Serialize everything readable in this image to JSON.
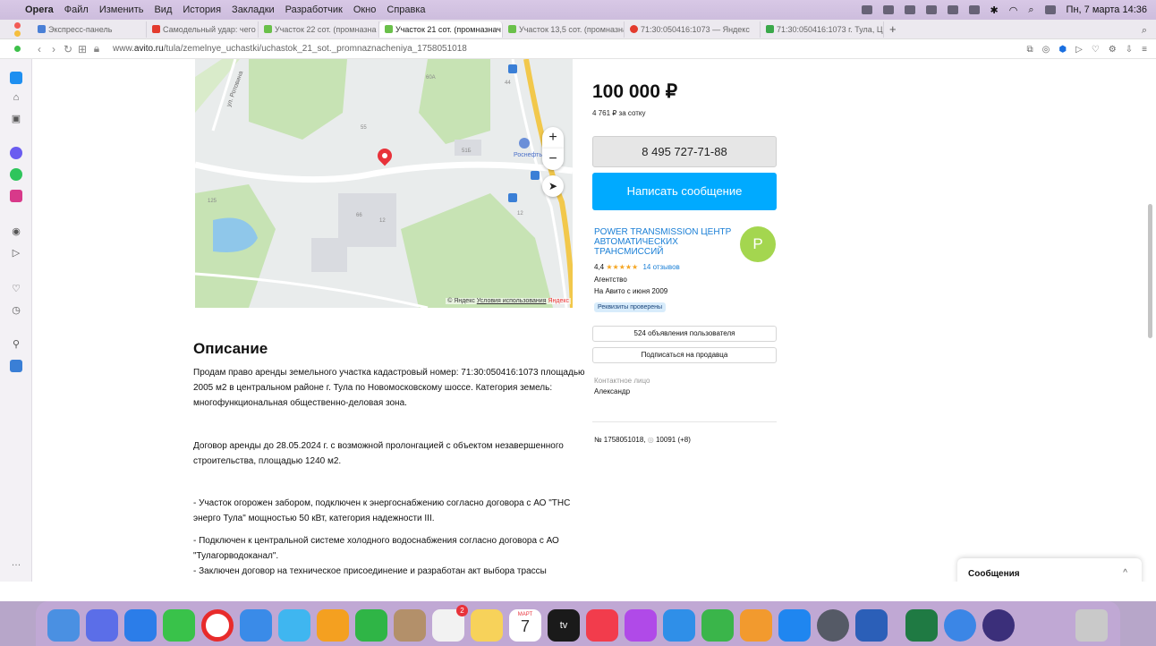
{
  "menubar": {
    "app": "Opera",
    "items": [
      "Файл",
      "Изменить",
      "Вид",
      "История",
      "Закладки",
      "Разработчик",
      "Окно",
      "Справка"
    ],
    "clock": "Пн, 7 марта  14:36"
  },
  "tabs": [
    {
      "label": "Экспресс-панель",
      "color": "#4a7fd6"
    },
    {
      "label": "Самодельный удар: чего ждё",
      "color": "#e33b2e"
    },
    {
      "label": "Участок 22 сот. (промназна",
      "color": "#6ac04a"
    },
    {
      "label": "Участок 21 сот. (промназнач",
      "color": "#6ac04a"
    },
    {
      "label": "Участок 13,5 сот. (промназна",
      "color": "#6ac04a"
    },
    {
      "label": "71:30:050416:1073 — Яндекс",
      "color": "#e33b2e"
    },
    {
      "label": "71:30:050416:1073 г. Тула, Ц",
      "color": "#3aa84a"
    }
  ],
  "address": {
    "prefix": "www.",
    "host": "avito.ru",
    "path": "/tula/zemelnye_uchastki/uchastok_21_sot._promnaznacheniya_1758051018"
  },
  "map": {
    "street": "ул. Ротовина",
    "plus": "+",
    "minus": "−",
    "copyright": "© Яндекс",
    "terms": "Условия использования",
    "brand": "Яндекс",
    "poi": "Роснефть",
    "labels": [
      "60А",
      "55",
      "51Б",
      "66",
      "12",
      "125",
      "44",
      "12"
    ]
  },
  "listing": {
    "price": "100 000 ₽",
    "per_hundred": "4 761 ₽ за сотку",
    "phone": "8 495 727-71-88",
    "message_button": "Написать сообщение",
    "seller_name": "POWER TRANSMISSION ЦЕНТР АВТОМАТИЧЕСКИХ ТРАНСМИССИЙ",
    "avatar_letter": "P",
    "rating": "4,4",
    "stars": "★★★★★",
    "reviews": "14 отзывов",
    "seller_type": "Агентство",
    "since": "На Авито с июня 2009",
    "verified": "Реквизиты проверены",
    "ads_button": "524 объявления пользователя",
    "subscribe_button": "Подписаться на продавца",
    "contact_label": "Контактное лицо",
    "contact_name": "Александр",
    "ad_number": "№ 1758051018,",
    "views": "10091 (+8)"
  },
  "description": {
    "title": "Описание",
    "p1": "Продам право аренды земельного участка кадастровый номер: 71:30:050416:1073 площадью 2005 м2 в центральном районе г. Тула по Новомосковскому шоссе. Категория земель: многофункциональная общественно-деловая зона.",
    "p2": "Договор аренды до 28.05.2024 г. с возможной пролонгацией с объектом незавершенного строительства, площадью 1240 м2.",
    "p3": "- Участок огорожен забором, подключен к энергоснабжению согласно договора с АО \"ТНС энерго Тула\" мощностью 50 кВт, категория надежности III.",
    "p4": "- Подключен к центральной системе холодного водоснабжения согласно договора с АО \"Тулагорводоканал\".",
    "p5": "- Заключен договор на техническое присоединение и разработан акт выбора трассы газопровода высокого давления согласно договора с АО \"Тулагоргаз\"."
  },
  "messages": {
    "label": "Сообщения",
    "chevron": "^"
  },
  "dock": {
    "calendar_month": "МАРТ",
    "calendar_day": "7",
    "appletv": "tv",
    "reminders_badge": "2",
    "icon_colors": [
      "#4a90e2",
      "#5b6ee8",
      "#2b7de9",
      "#39c24a",
      "#e82b2b",
      "#3a8be8",
      "#3fb6f0",
      "#f4a020",
      "#2fb546",
      "#b3906a",
      "#f2f2f2",
      "#f7d25a",
      "#e6e6e6",
      "#1a1a1a",
      "#f23c4c",
      "#b04ae8",
      "#2f8fe8",
      "#3ab54a",
      "#f29a2e",
      "#1f86f0",
      "#555a66",
      "#2b5fb8",
      "#1f7a43",
      "#3b86e6",
      "#3b2f7a",
      "#c9c9c9"
    ]
  }
}
